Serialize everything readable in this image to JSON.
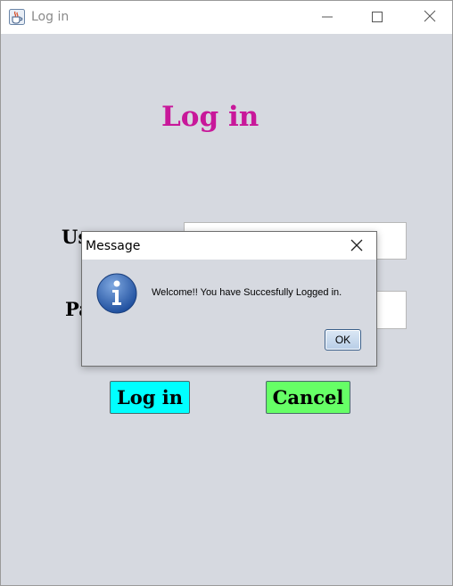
{
  "window": {
    "title": "Log in",
    "icon": "java-cup-icon",
    "controls": [
      "minimize-icon",
      "maximize-icon",
      "close-icon"
    ]
  },
  "form": {
    "heading": "Log in",
    "heading_color": "#c8189a",
    "username_label": "Us",
    "password_label": "Pa",
    "username_value": "",
    "password_value": "",
    "login_button": "Log in",
    "login_button_color": "#00ffff",
    "cancel_button": "Cancel",
    "cancel_button_color": "#66ff66",
    "background_color": "#d6d9e0"
  },
  "dialog": {
    "title": "Message",
    "icon": "info-icon",
    "message": "Welcome!! You have Succesfully Logged in.",
    "ok_button": "OK"
  }
}
